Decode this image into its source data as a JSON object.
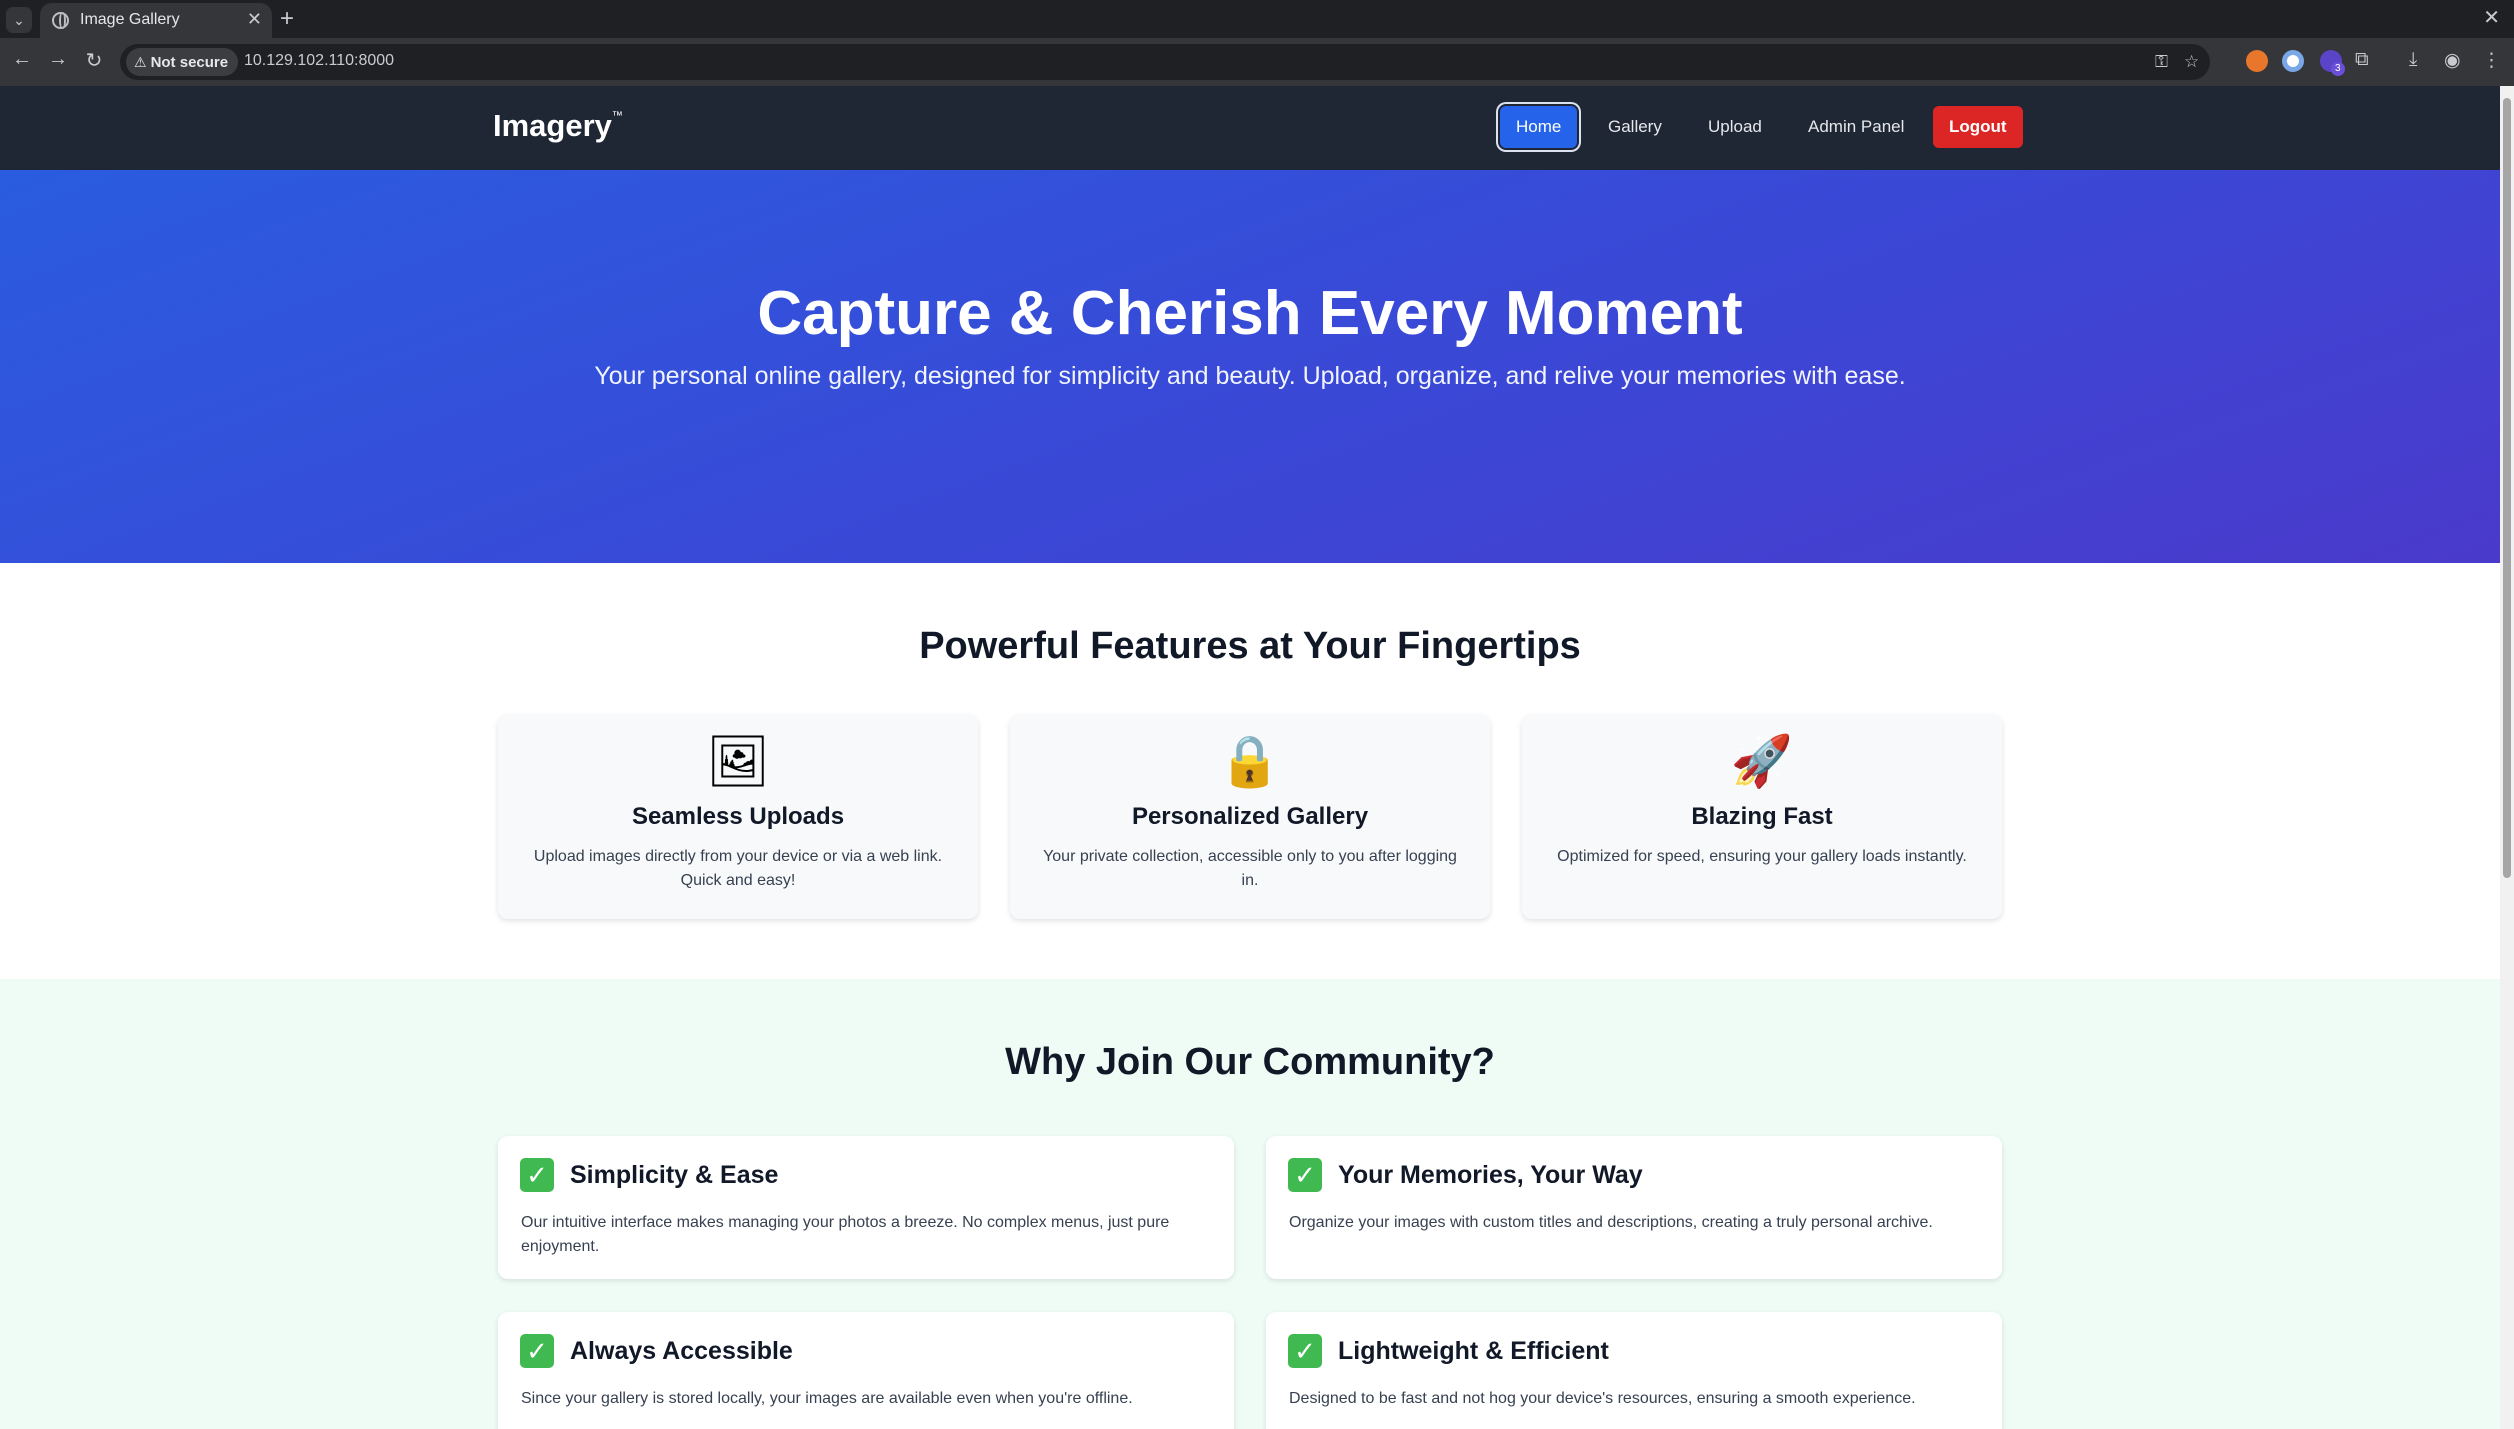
{
  "browser": {
    "tab_title": "Image Gallery",
    "security_label": "Not secure",
    "url": "10.129.102.110:8000",
    "extension_badge": "3"
  },
  "site": {
    "brand": "Imagery",
    "brand_mark": "™",
    "nav": {
      "home": "Home",
      "gallery": "Gallery",
      "upload": "Upload",
      "admin": "Admin Panel",
      "logout": "Logout"
    }
  },
  "hero": {
    "title": "Capture & Cherish Every Moment",
    "subtitle": "Your personal online gallery, designed for simplicity and beauty. Upload, organize, and relive your memories with ease."
  },
  "features": {
    "title": "Powerful Features at Your Fingertips",
    "items": [
      {
        "icon": "framed-picture-icon",
        "glyph": "🖼",
        "title": "Seamless Uploads",
        "desc": "Upload images directly from your device or via a web link. Quick and easy!"
      },
      {
        "icon": "lock-icon",
        "glyph": "🔒",
        "title": "Personalized Gallery",
        "desc": "Your private collection, accessible only to you after logging in."
      },
      {
        "icon": "rocket-icon",
        "glyph": "🚀",
        "title": "Blazing Fast",
        "desc": "Optimized for speed, ensuring your gallery loads instantly."
      }
    ]
  },
  "community": {
    "title": "Why Join Our Community?",
    "check_glyph": "✓",
    "items": [
      {
        "title": "Simplicity & Ease",
        "desc": "Our intuitive interface makes managing your photos a breeze. No complex menus, just pure enjoyment."
      },
      {
        "title": "Your Memories, Your Way",
        "desc": "Organize your images with custom titles and descriptions, creating a truly personal archive."
      },
      {
        "title": "Always Accessible",
        "desc": "Since your gallery is stored locally, your images are available even when you're offline."
      },
      {
        "title": "Lightweight & Efficient",
        "desc": "Designed to be fast and not hog your device's resources, ensuring a smooth experience."
      }
    ]
  },
  "colors": {
    "nav_bg": "#1f2734",
    "primary": "#2563eb",
    "danger": "#dc2626",
    "hero_start": "#2a5cdf",
    "hero_end": "#4a3acb",
    "community_bg": "#effbf5",
    "check_green": "#3fb950"
  }
}
